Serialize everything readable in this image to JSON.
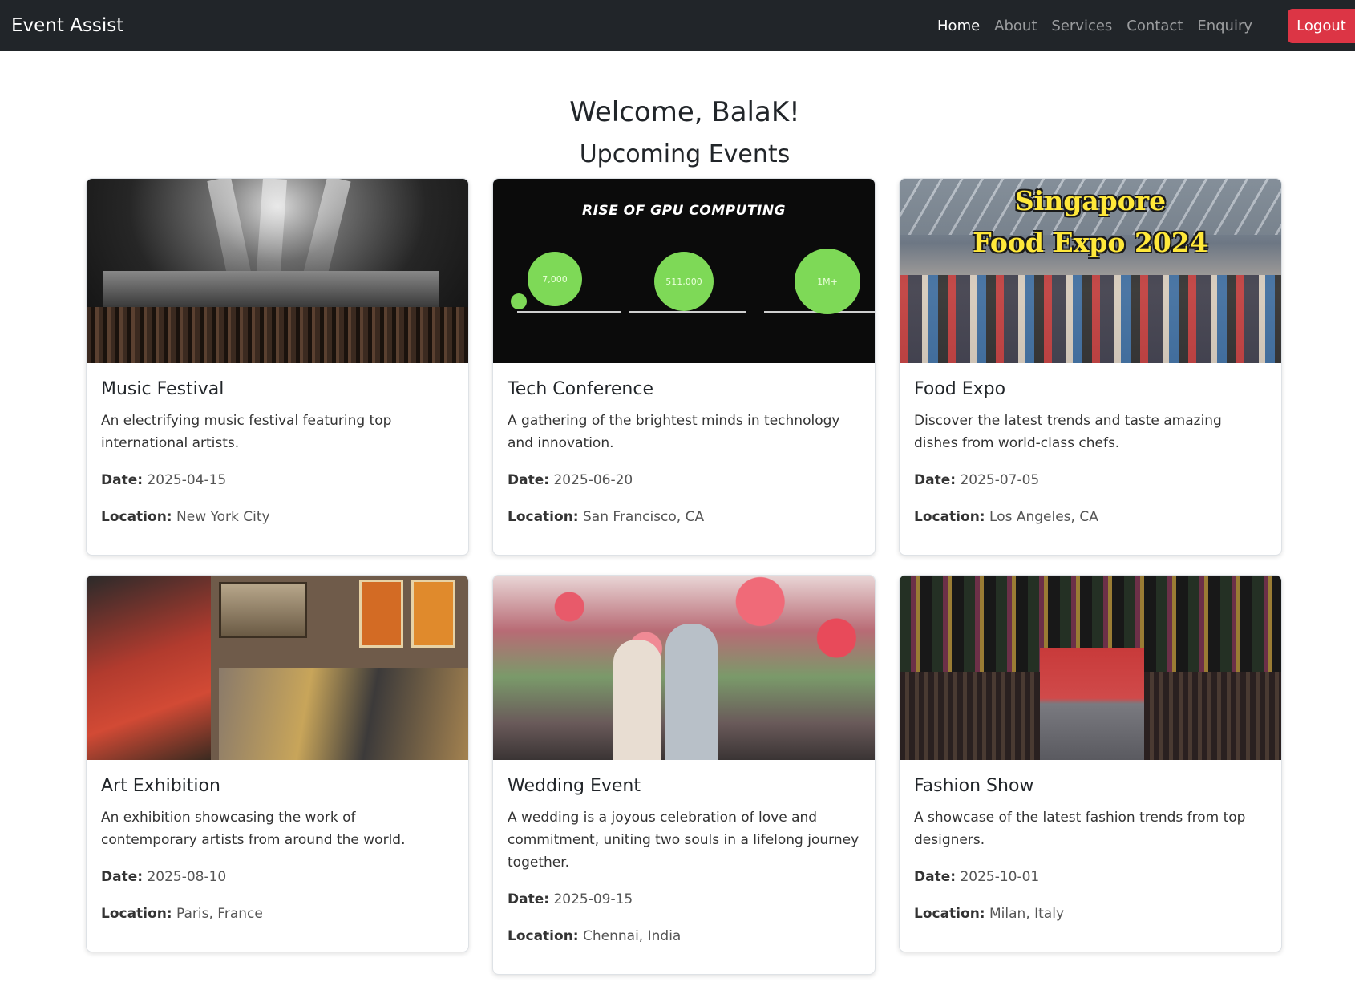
{
  "navbar": {
    "brand": "Event Assist",
    "links": [
      "Home",
      "About",
      "Services",
      "Contact",
      "Enquiry"
    ],
    "active_link": "Home",
    "logout_label": "Logout"
  },
  "main": {
    "welcome": "Welcome, BalaK!",
    "section_title": "Upcoming Events"
  },
  "labels": {
    "date": "Date:",
    "location": "Location:"
  },
  "events": [
    {
      "title": "Music Festival",
      "description": "An electrifying music festival featuring top international artists.",
      "date": "2025-04-15",
      "location": "New York City"
    },
    {
      "title": "Tech Conference",
      "description": "A gathering of the brightest minds in technology and innovation.",
      "date": "2025-06-20",
      "location": "San Francisco, CA",
      "image_text": {
        "headline": "RISE OF GPU COMPUTING",
        "stats": [
          "7,000",
          "511,000",
          "1M+"
        ]
      }
    },
    {
      "title": "Food Expo",
      "description": "Discover the latest trends and taste amazing dishes from world-class chefs.",
      "date": "2025-07-05",
      "location": "Los Angeles, CA",
      "image_text": {
        "line1": "Singapore",
        "line2": "Food Expo 2024"
      }
    },
    {
      "title": "Art Exhibition",
      "description": "An exhibition showcasing the work of contemporary artists from around the world.",
      "date": "2025-08-10",
      "location": "Paris, France"
    },
    {
      "title": "Wedding Event",
      "description": "A wedding is a joyous celebration of love and commitment, uniting two souls in a lifelong journey together.",
      "date": "2025-09-15",
      "location": "Chennai, India"
    },
    {
      "title": "Fashion Show",
      "description": "A showcase of the latest fashion trends from top designers.",
      "date": "2025-10-01",
      "location": "Milan, Italy"
    }
  ],
  "colors": {
    "navbar_bg": "#212529",
    "logout_bg": "#dc3545",
    "tech_circle": "#7ed957",
    "food_title": "#ffe83a"
  }
}
